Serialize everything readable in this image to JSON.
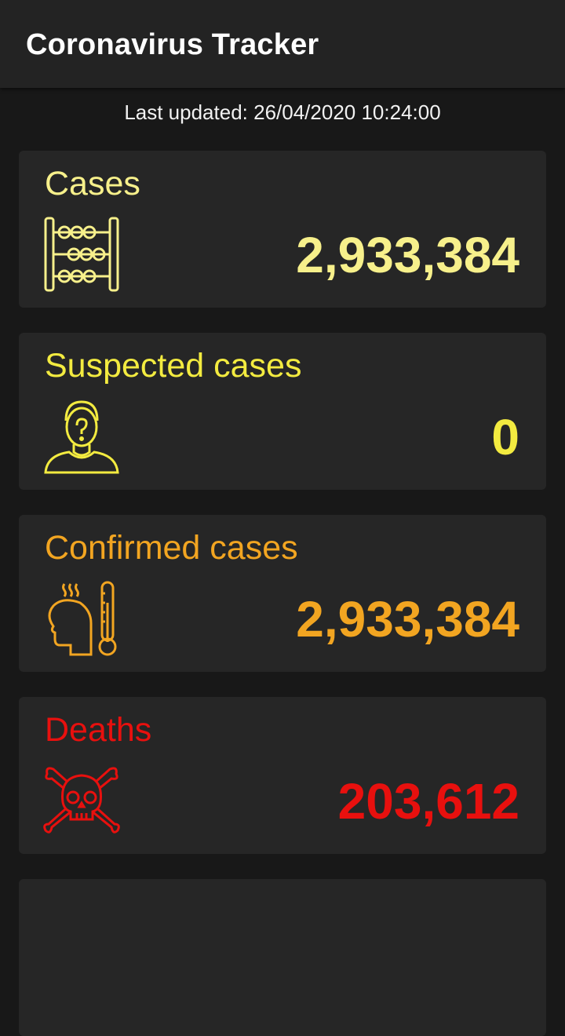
{
  "app": {
    "title": "Coronavirus Tracker"
  },
  "status": {
    "last_updated": "Last updated: 26/04/2020 10:24:00"
  },
  "cards": [
    {
      "title": "Cases",
      "value": "2,933,384",
      "icon": "abacus-icon",
      "color": "#f7f08b"
    },
    {
      "title": "Suspected cases",
      "value": "0",
      "icon": "suspected-person-icon",
      "color": "#f3eb40"
    },
    {
      "title": "Confirmed cases",
      "value": "2,933,384",
      "icon": "fever-thermometer-icon",
      "color": "#f2a521"
    },
    {
      "title": "Deaths",
      "value": "203,612",
      "icon": "skull-crossbones-icon",
      "color": "#e8100e"
    }
  ]
}
